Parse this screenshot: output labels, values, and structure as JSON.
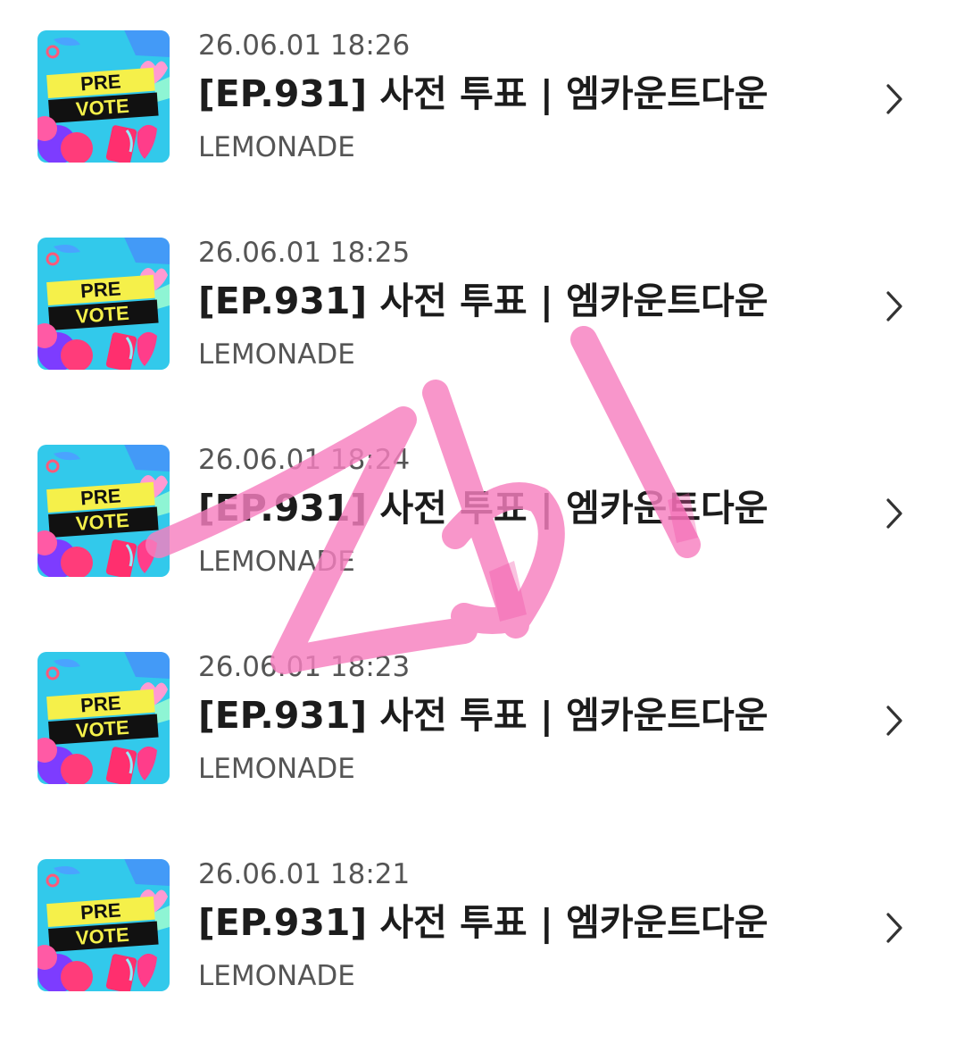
{
  "items": [
    {
      "date": "26.06.01 18:26",
      "title": "[EP.931] 사전 투표 | 엠카운트다운",
      "source": "LEMONADE",
      "thumbnail": {
        "line1": "PRE",
        "line2": "VOTE"
      }
    },
    {
      "date": "26.06.01 18:25",
      "title": "[EP.931] 사전 투표 | 엠카운트다운",
      "source": "LEMONADE",
      "thumbnail": {
        "line1": "PRE",
        "line2": "VOTE"
      }
    },
    {
      "date": "26.06.01 18:24",
      "title": "[EP.931] 사전 투표 | 엠카운트다운",
      "source": "LEMONADE",
      "thumbnail": {
        "line1": "PRE",
        "line2": "VOTE"
      }
    },
    {
      "date": "26.06.01 18:23",
      "title": "[EP.931] 사전 투표 | 엠카운트다운",
      "source": "LEMONADE",
      "thumbnail": {
        "line1": "PRE",
        "line2": "VOTE"
      }
    },
    {
      "date": "26.06.01 18:21",
      "title": "[EP.931] 사전 투표 | 엠카운트다운",
      "source": "LEMONADE",
      "thumbnail": {
        "line1": "PRE",
        "line2": "VOTE"
      }
    }
  ],
  "handwritten_overlay": {
    "text": "ZbI",
    "color": "#f77fbf"
  },
  "colors": {
    "title": "#1c1c1c",
    "meta": "#555555",
    "chevron": "#333333",
    "thumb_bg": "#2fd3e8",
    "thumb_banner": "#f5f04a"
  },
  "icons": {
    "row_arrow": "chevron-right-icon"
  }
}
